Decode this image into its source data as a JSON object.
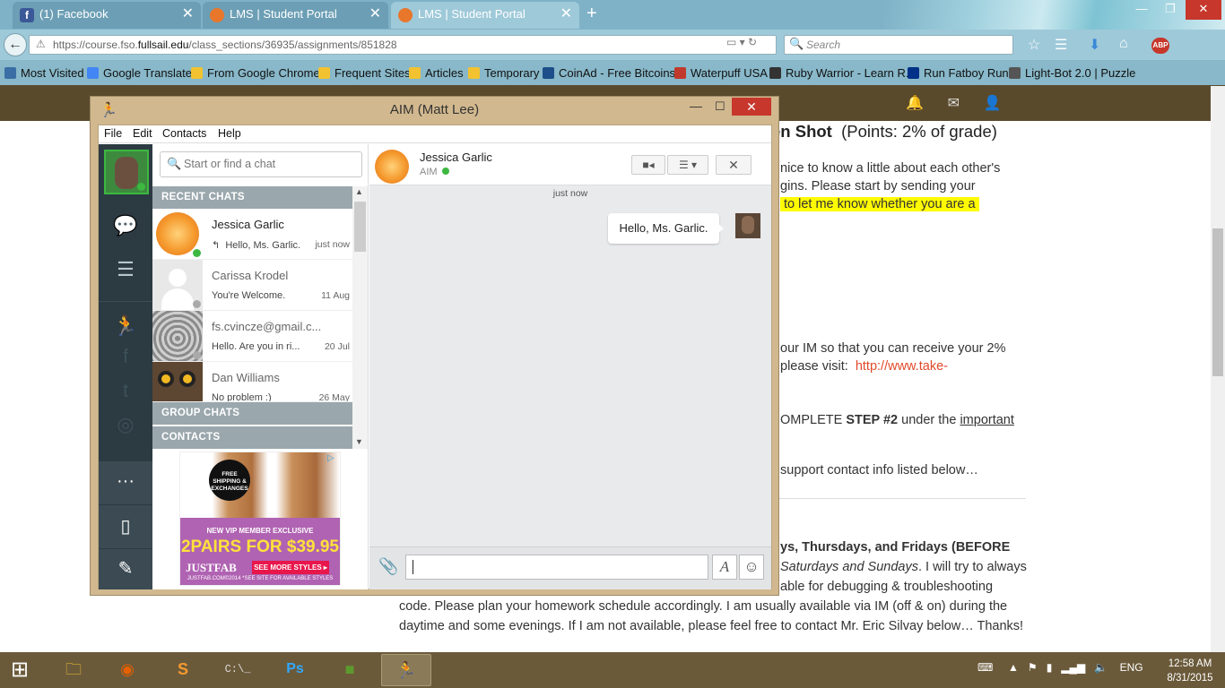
{
  "browser": {
    "tabs": [
      {
        "title": "(1) Facebook",
        "icon": "facebook-icon",
        "color": "#3b5998"
      },
      {
        "title": "LMS | Student Portal",
        "icon": "fullsail-icon",
        "color": "#e8762b"
      },
      {
        "title": "LMS | Student Portal",
        "icon": "fullsail-icon",
        "color": "#e8762b",
        "active": true
      }
    ],
    "new_tab": "+",
    "url": {
      "prefix": "https://course.fso.",
      "domain": "fullsail.edu",
      "path": "/class_sections/36935/assignments/851828"
    },
    "search_placeholder": "Search",
    "bookmarks": [
      {
        "label": "Most Visited",
        "icon": "globe-icon",
        "color": "#3a6ea5"
      },
      {
        "label": "Google Translate",
        "icon": "translate-icon",
        "color": "#4285f4"
      },
      {
        "label": "From Google Chrome",
        "icon": "folder-icon",
        "color": "#f2c230"
      },
      {
        "label": "Frequent Sites",
        "icon": "folder-icon",
        "color": "#f2c230"
      },
      {
        "label": "Articles",
        "icon": "folder-icon",
        "color": "#f2c230"
      },
      {
        "label": "Temporary",
        "icon": "folder-icon",
        "color": "#f2c230"
      },
      {
        "label": "CoinAd - Free Bitcoins",
        "icon": "coinad-icon",
        "color": "#1d4e89"
      },
      {
        "label": "Waterpuff USA",
        "icon": "waterpuff-icon",
        "color": "#c0392b"
      },
      {
        "label": "Ruby Warrior - Learn R...",
        "icon": "ruby-warrior-icon",
        "color": "#333333"
      },
      {
        "label": "Run Fatboy Run",
        "icon": "paypal-icon",
        "color": "#003087"
      },
      {
        "label": "Light-Bot 2.0 | Puzzle ...",
        "icon": "shield-icon",
        "color": "#555555"
      }
    ]
  },
  "page": {
    "title_bold": "en Shot",
    "title_rest": "(Points: 2% of grade)",
    "lines": [
      "nice to know a little about each other's",
      "gins. Please start by sending your",
      "to let me know whether you are a",
      "our IM so that you can receive your 2%",
      "please visit:",
      "http://www.take-",
      "OMPLETE",
      "STEP #2",
      "under the",
      "important",
      "support contact info listed below…",
      "ys, Thursdays, and Fridays (BEFORE",
      "Saturdays and Sundays",
      ".  I will try to always",
      "able for debugging & troubleshooting",
      "code.  Please plan your homework schedule accordingly.   I am usually available via IM (off & on) during the",
      "daytime and some evenings.  If I am not available, please feel free to contact Mr. Eric Silvay below… Thanks!"
    ]
  },
  "aim": {
    "title": "AIM (Matt Lee)",
    "menu": [
      "File",
      "Edit",
      "Contacts",
      "Help"
    ],
    "search_placeholder": "Start or find a chat",
    "sections": {
      "recent": "RECENT CHATS",
      "group": "GROUP CHATS",
      "contacts": "CONTACTS"
    },
    "chats": [
      {
        "name": "Jessica Garlic",
        "preview": "Hello, Ms. Garlic.",
        "time": "just now",
        "status": "online",
        "status_color": "#3db840",
        "avatar": "orange-avatar"
      },
      {
        "name": "Carissa Krodel",
        "preview": "You're Welcome.",
        "time": "11 Aug",
        "status": "offline",
        "status_color": "#aaaaaa",
        "avatar": "default-avatar"
      },
      {
        "name": "fs.cvincze@gmail.c...",
        "preview": "Hello. Are you in ri...",
        "time": "20 Jul",
        "status": "offline",
        "status_color": "#aaaaaa",
        "avatar": "stones-avatar"
      },
      {
        "name": "Dan Williams",
        "preview": "No problem :)",
        "time": "26 May",
        "status": "offline",
        "status_color": "#aaaaaa",
        "avatar": "owl-avatar"
      }
    ],
    "ad": {
      "badge": "FREE SHIPPING & EXCHANGES",
      "line1": "NEW VIP MEMBER EXCLUSIVE",
      "line2": "2PAIRS FOR $39.95",
      "brand": "JUSTFAB",
      "cta": "SEE MORE STYLES ▸",
      "fine": "JUSTFAB.COM©2014 *SEE SITE FOR AVAILABLE STYLES"
    },
    "conversation": {
      "name": "Jessica Garlic",
      "status": "AIM",
      "timestamp": "just now",
      "messages": [
        {
          "text": "Hello, Ms. Garlic.",
          "from": "me"
        }
      ],
      "input_value": ""
    }
  },
  "taskbar": {
    "apps": [
      "file-explorer-icon",
      "firefox-icon",
      "sublime-text-icon",
      "command-prompt-icon",
      "photoshop-icon",
      "minecraft-icon",
      "aim-icon"
    ],
    "language": "ENG",
    "time": "12:58 AM",
    "date": "8/31/2015"
  }
}
